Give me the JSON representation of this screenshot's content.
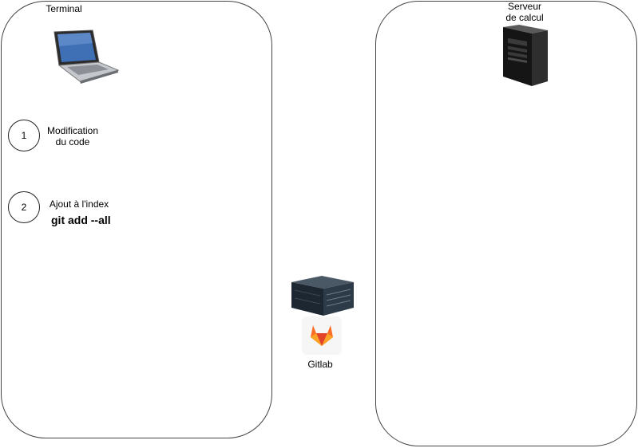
{
  "terminal": {
    "title": "Terminal",
    "laptop_icon": "laptop-icon"
  },
  "server": {
    "title_line1": "Serveur",
    "title_line2": "de calcul",
    "tower_icon": "server-tower-icon"
  },
  "steps": [
    {
      "number": "1",
      "label_line1": "Modification",
      "label_line2": "du code"
    },
    {
      "number": "2",
      "label_line1": "Ajout à l'index",
      "command": "git add --all"
    }
  ],
  "gitlab": {
    "label": "Gitlab",
    "rack_icon": "rack-server-icon",
    "logo_icon": "gitlab-fox-icon"
  }
}
